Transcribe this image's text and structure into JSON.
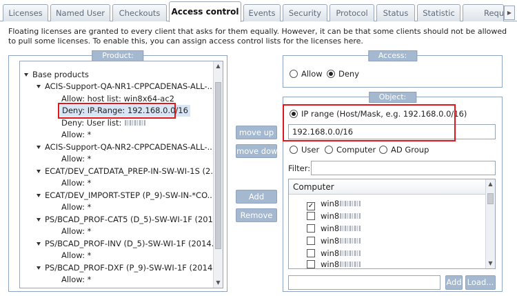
{
  "tabs": [
    "Licenses",
    "Named User",
    "Checkouts",
    "Access control",
    "Events",
    "Security",
    "Protocol",
    "Status",
    "Statistic",
    "Requ"
  ],
  "active_tab": "Access control",
  "info_text": "Floating licenses are granted to every client that asks for them equally. However, it can be that some clients should not be allowed to pull some licenses. To enable this, you can assign access control lists for the licenses here.",
  "product": {
    "title": "Product:",
    "tree": [
      "Base products",
      "ACIS-Support-QA-NR1-CPPCADENAS-ALL-...",
      "Allow: host list: win8x64-ac2",
      "Deny: IP-Range: 192.168.0.0/16",
      "Deny: User list:",
      "Allow: *",
      "ACIS-Support-QA-NR2-CPPCADENAS-ALL-...",
      "Allow: *",
      "ECAT/DEV_CATDATA_PREP-IN-SW-WI-1S (2...",
      "Allow: *",
      "ECAT/DEV_IMPORT-STEP (P_9)-SW-IN-*CO...",
      "Allow: *",
      "PS/BCAD_PROF-CAT5 (D_5)-SW-WI-1F (201...",
      "Allow: *",
      "PS/BCAD_PROF-INV (D_5)-SW-WI-1F (2014...",
      "Allow: *",
      "PS/BCAD_PROF-DXF (P_9)-SW-WI-1F (2014...",
      "Allow: *"
    ]
  },
  "middle_buttons": {
    "move_up": "move up",
    "move_down": "move down",
    "add": "Add",
    "remove": "Remove"
  },
  "access": {
    "title": "Access:",
    "allow_label": "Allow",
    "deny_label": "Deny",
    "selected": "Deny"
  },
  "object": {
    "title": "Object:",
    "ip_range_label": "IP range  (Host/Mask,  e.g. 192.168.0.0/16)",
    "ip_value": "192.168.0.0/16",
    "user_label": "User",
    "computer_label": "Computer",
    "ad_group_label": "AD Group",
    "filter_label": "Filter:",
    "filter_value": "",
    "list_header": "Computer",
    "computers": [
      {
        "name": "win8",
        "checked": true
      },
      {
        "name": "win8",
        "checked": false
      },
      {
        "name": "win8",
        "checked": false
      },
      {
        "name": "win8",
        "checked": false
      },
      {
        "name": "win8",
        "checked": false
      },
      {
        "name": "win8",
        "checked": false
      }
    ],
    "add_input_value": "",
    "add_button": "Add",
    "load_button": "Load..."
  },
  "colors": {
    "highlight_box": "#e0161b",
    "group_title_bg": "#a4b8d0",
    "selected_row": "#d7e5f5"
  }
}
